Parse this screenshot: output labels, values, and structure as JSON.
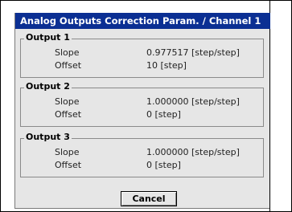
{
  "window": {
    "title": "Analog Outputs Correction Param. / Channel 1"
  },
  "groups": [
    {
      "title": "Output 1",
      "slope_label": "Slope",
      "slope_value": "0.977517 [step/step]",
      "offset_label": "Offset",
      "offset_value": "10 [step]"
    },
    {
      "title": "Output 2",
      "slope_label": "Slope",
      "slope_value": "1.000000 [step/step]",
      "offset_label": "Offset",
      "offset_value": "0 [step]"
    },
    {
      "title": "Output 3",
      "slope_label": "Slope",
      "slope_value": "1.000000 [step/step]",
      "offset_label": "Offset",
      "offset_value": "0 [step]"
    }
  ],
  "buttons": {
    "cancel_label": "Cancel"
  },
  "colors": {
    "titlebar": "#0b2f93",
    "dialog_background": "#e6e6e6"
  }
}
